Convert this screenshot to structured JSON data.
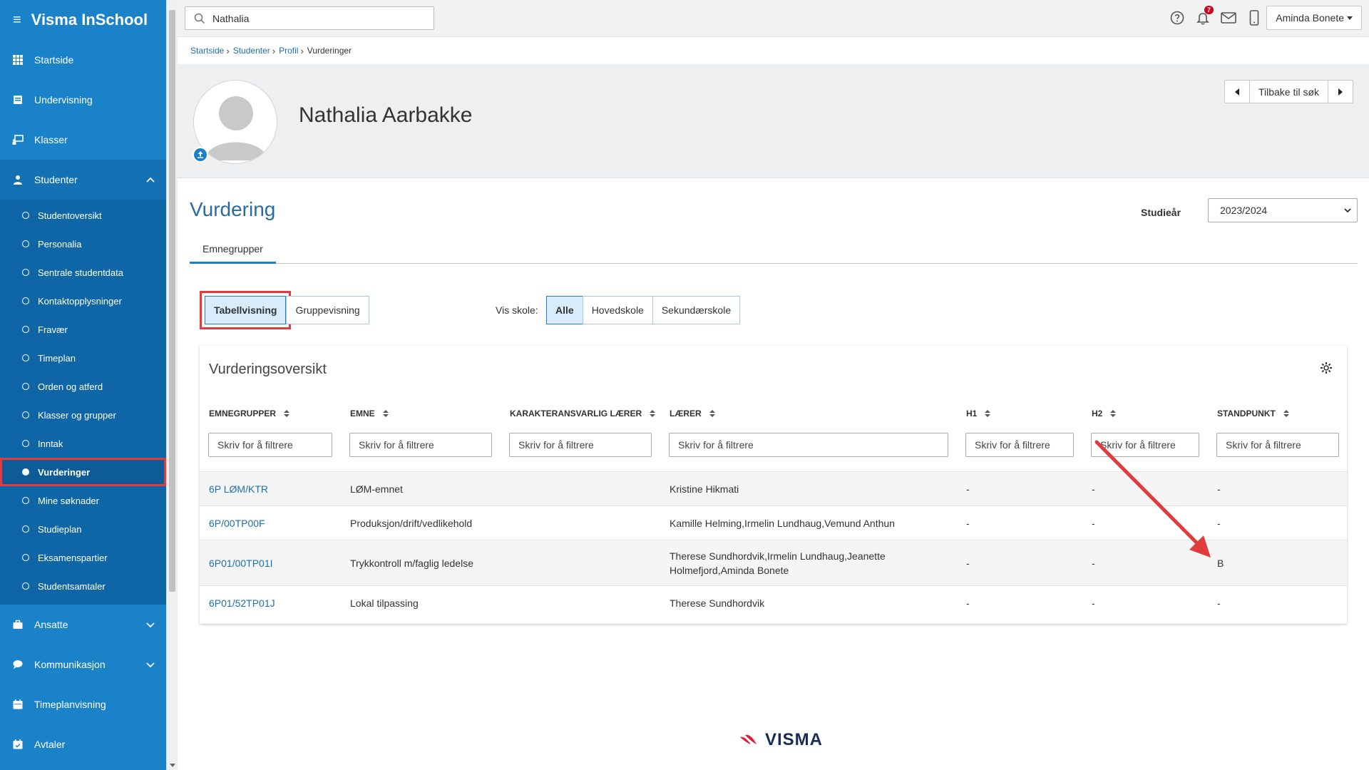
{
  "app": {
    "title": "Visma InSchool"
  },
  "sidebar": {
    "items": [
      {
        "label": "Startside"
      },
      {
        "label": "Undervisning"
      },
      {
        "label": "Klasser"
      },
      {
        "label": "Studenter"
      },
      {
        "label": "Ansatte"
      },
      {
        "label": "Kommunikasjon"
      },
      {
        "label": "Timeplanvisning"
      },
      {
        "label": "Avtaler"
      }
    ],
    "student_sub": [
      {
        "label": "Studentoversikt"
      },
      {
        "label": "Personalia"
      },
      {
        "label": "Sentrale studentdata"
      },
      {
        "label": "Kontaktopplysninger"
      },
      {
        "label": "Fravær"
      },
      {
        "label": "Timeplan"
      },
      {
        "label": "Orden og atferd"
      },
      {
        "label": "Klasser og grupper"
      },
      {
        "label": "Inntak"
      },
      {
        "label": "Vurderinger"
      },
      {
        "label": "Mine søknader"
      },
      {
        "label": "Studieplan"
      },
      {
        "label": "Eksamenspartier"
      },
      {
        "label": "Studentsamtaler"
      }
    ]
  },
  "topbar": {
    "search_value": "Nathalia",
    "notification_count": "7",
    "user_name": "Aminda Bonete"
  },
  "breadcrumb": [
    "Startside",
    "Studenter",
    "Profil",
    "Vurderinger"
  ],
  "profile": {
    "name": "Nathalia Aarbakke",
    "back_label": "Tilbake til søk"
  },
  "page": {
    "heading": "Vurdering",
    "year_label": "Studieår",
    "year_value": "2023/2024",
    "tab": "Emnegrupper",
    "view_options": [
      "Tabellvisning",
      "Gruppevisning"
    ],
    "school_label": "Vis skole:",
    "school_options": [
      "Alle",
      "Hovedskole",
      "Sekundærskole"
    ]
  },
  "table": {
    "title": "Vurderingsoversikt",
    "columns": [
      "EMNEGRUPPER",
      "EMNE",
      "KARAKTERANSVARLIG LÆRER",
      "LÆRER",
      "H1",
      "H2",
      "STANDPUNKT"
    ],
    "filter_placeholder": "Skriv for å filtrere",
    "rows": [
      {
        "group": "6P LØM/KTR",
        "subject": "LØM-emnet",
        "resp": "",
        "teacher": "Kristine Hikmati",
        "h1": "-",
        "h2": "-",
        "stand": "-"
      },
      {
        "group": "6P/00TP00F",
        "subject": "Produksjon/drift/vedlikehold",
        "resp": "",
        "teacher": "Kamille Helming,Irmelin Lundhaug,Vemund Anthun",
        "h1": "-",
        "h2": "-",
        "stand": "-"
      },
      {
        "group": "6P01/00TP01I",
        "subject": "Trykkontroll m/faglig ledelse",
        "resp": "",
        "teacher": "Therese Sundhordvik,Irmelin Lundhaug,Jeanette Holmefjord,Aminda Bonete",
        "h1": "-",
        "h2": "-",
        "stand": "B"
      },
      {
        "group": "6P01/52TP01J",
        "subject": "Lokal tilpassing",
        "resp": "",
        "teacher": "Therese Sundhordvik",
        "h1": "-",
        "h2": "-",
        "stand": "-"
      }
    ]
  },
  "footer": {
    "logo_text": "VISMA"
  },
  "colors": {
    "sidebar": "#1a82c9",
    "accent": "#1a82c9",
    "highlight": "#e23b3b"
  }
}
